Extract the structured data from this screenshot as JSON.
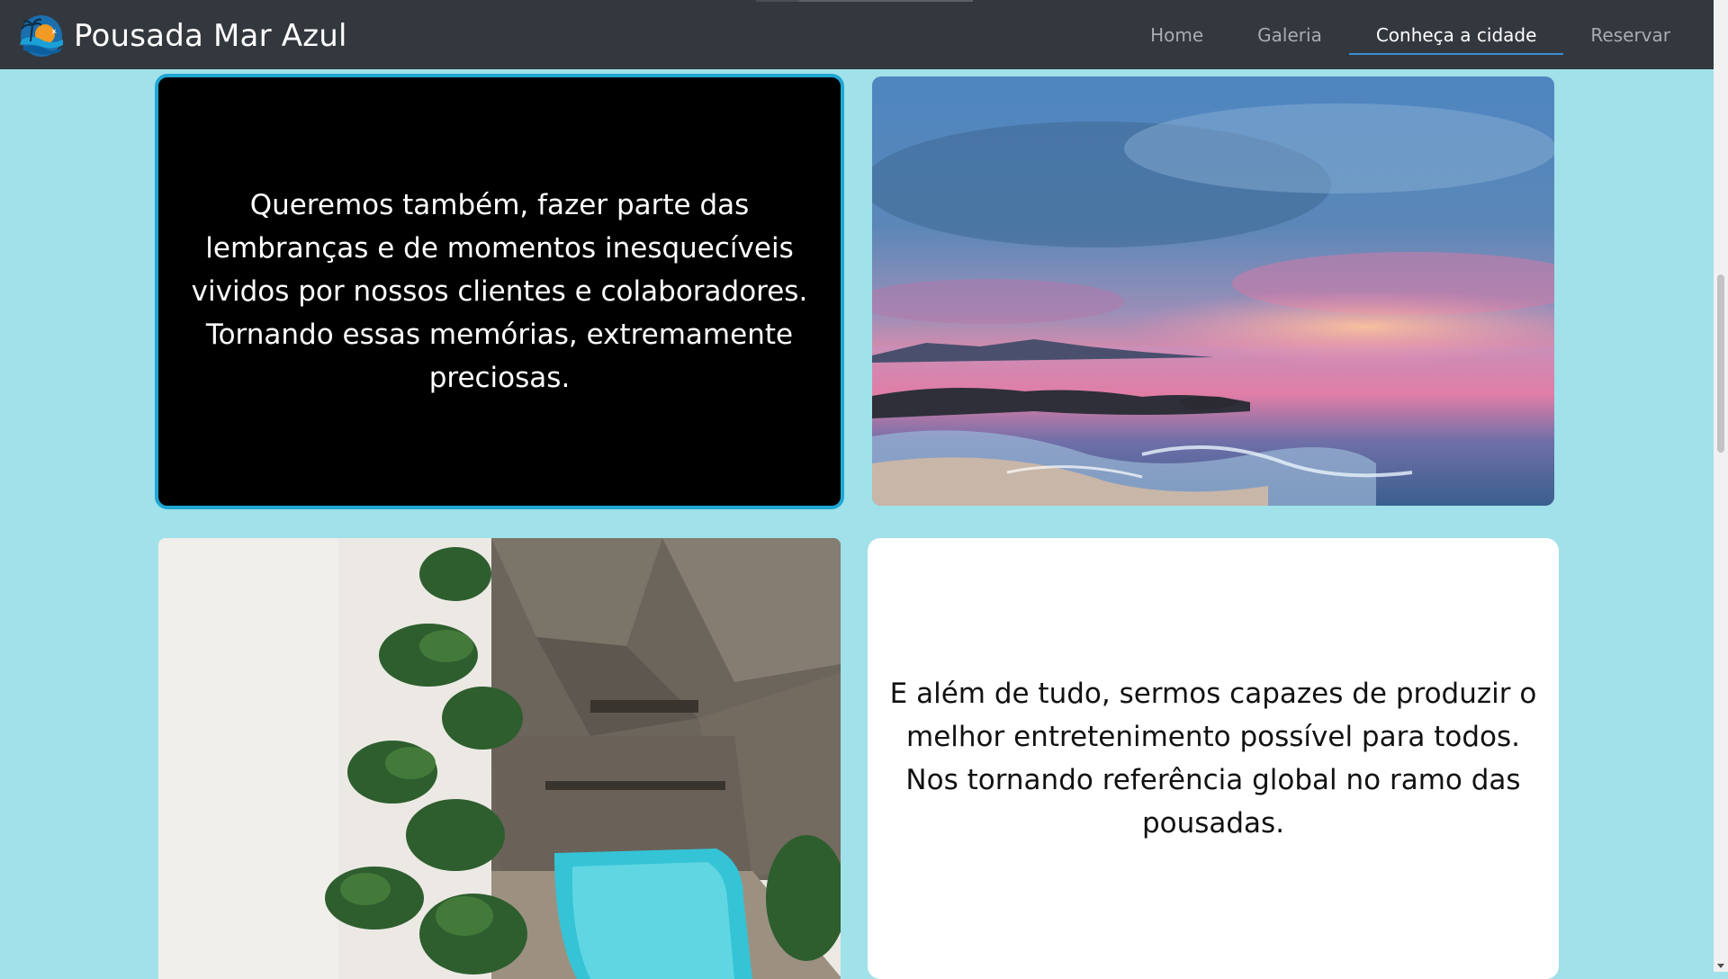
{
  "brand": {
    "title": "Pousada Mar Azul",
    "logo_icon": "beach-sunset-logo"
  },
  "nav": {
    "items": [
      {
        "label": "Home",
        "active": false
      },
      {
        "label": "Galeria",
        "active": false
      },
      {
        "label": "Conheça a cidade",
        "active": true
      },
      {
        "label": "Reservar",
        "active": false
      }
    ]
  },
  "cards": {
    "first_text": "Queremos também, fazer parte das lembranças e de momentos inesquecíveis vividos por nossos clientes e colaboradores. Tornando essas memórias, extremamente preciosas.",
    "second_text": "E além de tudo, sermos capazes de produzir o melhor entretenimento possível para todos. Nos tornando referência global no ramo das pousadas."
  },
  "images": {
    "sunset": "sunset-sea-rocks-photo",
    "resort": "aerial-resort-pool-photo"
  },
  "colors": {
    "page_background": "#a0e1ea",
    "navbar": "#33383e",
    "active_underline": "#3b8ed4",
    "card_highlight_border": "#1fa7d3"
  }
}
